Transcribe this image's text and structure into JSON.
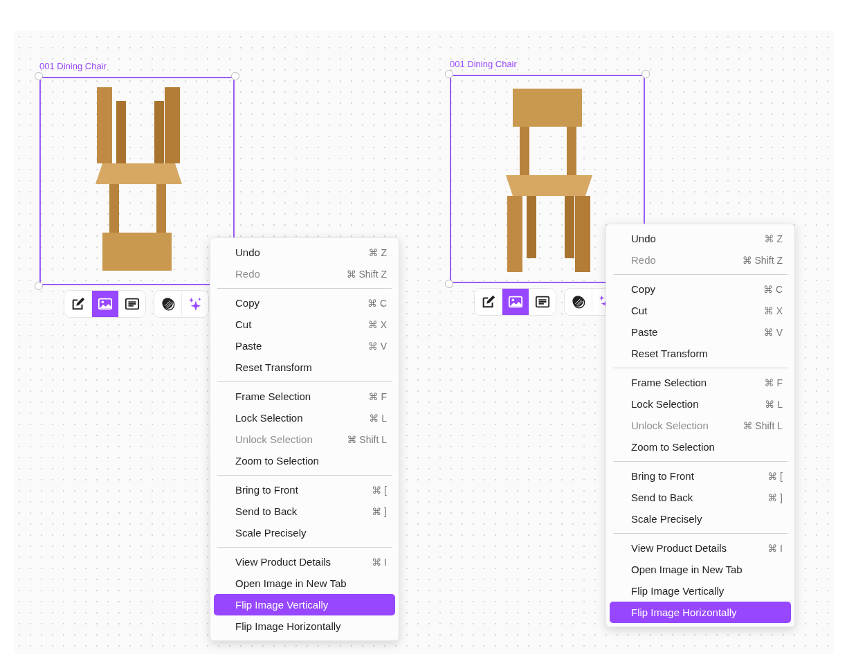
{
  "canvas": {
    "frames": [
      {
        "label": "001 Dining Chair",
        "image_flipped_vertically": true,
        "toolbar": [
          [
            {
              "kind": "edit",
              "selected": false
            },
            {
              "kind": "image",
              "selected": true
            },
            {
              "kind": "text",
              "selected": false
            }
          ],
          [
            {
              "kind": "mask",
              "selected": false
            },
            {
              "kind": "sparkle",
              "selected": false
            }
          ]
        ],
        "context_menu": {
          "sections": [
            [
              {
                "label": "Undo",
                "shortcut": "⌘ Z",
                "disabled": false,
                "selected": false
              },
              {
                "label": "Redo",
                "shortcut": "⌘ Shift Z",
                "disabled": true,
                "selected": false
              }
            ],
            [
              {
                "label": "Copy",
                "shortcut": "⌘ C",
                "disabled": false,
                "selected": false
              },
              {
                "label": "Cut",
                "shortcut": "⌘ X",
                "disabled": false,
                "selected": false
              },
              {
                "label": "Paste",
                "shortcut": "⌘ V",
                "disabled": false,
                "selected": false
              },
              {
                "label": "Reset Transform",
                "disabled": false,
                "selected": false
              }
            ],
            [
              {
                "label": "Frame Selection",
                "shortcut": "⌘ F",
                "disabled": false,
                "selected": false
              },
              {
                "label": "Lock Selection",
                "shortcut": "⌘ L",
                "disabled": false,
                "selected": false
              },
              {
                "label": "Unlock Selection",
                "shortcut": "⌘ Shift L",
                "disabled": true,
                "selected": false
              },
              {
                "label": "Zoom to Selection",
                "disabled": false,
                "selected": false
              }
            ],
            [
              {
                "label": "Bring to Front",
                "shortcut": "⌘ [",
                "disabled": false,
                "selected": false
              },
              {
                "label": "Send to Back",
                "shortcut": "⌘ ]",
                "disabled": false,
                "selected": false
              },
              {
                "label": "Scale Precisely",
                "disabled": false,
                "selected": false
              }
            ],
            [
              {
                "label": "View Product Details",
                "shortcut": "⌘ I",
                "disabled": false,
                "selected": false
              },
              {
                "label": "Open Image in New Tab",
                "disabled": false,
                "selected": false
              },
              {
                "label": "Flip Image Vertically",
                "disabled": false,
                "selected": true
              },
              {
                "label": "Flip Image Horizontally",
                "disabled": false,
                "selected": false
              }
            ]
          ]
        }
      },
      {
        "label": "001 Dining Chair",
        "image_flipped_vertically": false,
        "toolbar": [
          [
            {
              "kind": "edit",
              "selected": false
            },
            {
              "kind": "image",
              "selected": true
            },
            {
              "kind": "text",
              "selected": false
            }
          ],
          [
            {
              "kind": "mask",
              "selected": false
            },
            {
              "kind": "sparkle",
              "selected": false
            }
          ]
        ],
        "context_menu": {
          "sections": [
            [
              {
                "label": "Undo",
                "shortcut": "⌘ Z",
                "disabled": false,
                "selected": false
              },
              {
                "label": "Redo",
                "shortcut": "⌘ Shift Z",
                "disabled": true,
                "selected": false
              }
            ],
            [
              {
                "label": "Copy",
                "shortcut": "⌘ C",
                "disabled": false,
                "selected": false
              },
              {
                "label": "Cut",
                "shortcut": "⌘ X",
                "disabled": false,
                "selected": false
              },
              {
                "label": "Paste",
                "shortcut": "⌘ V",
                "disabled": false,
                "selected": false
              },
              {
                "label": "Reset Transform",
                "disabled": false,
                "selected": false
              }
            ],
            [
              {
                "label": "Frame Selection",
                "shortcut": "⌘ F",
                "disabled": false,
                "selected": false
              },
              {
                "label": "Lock Selection",
                "shortcut": "⌘ L",
                "disabled": false,
                "selected": false
              },
              {
                "label": "Unlock Selection",
                "shortcut": "⌘ Shift L",
                "disabled": true,
                "selected": false
              },
              {
                "label": "Zoom to Selection",
                "disabled": false,
                "selected": false
              }
            ],
            [
              {
                "label": "Bring to Front",
                "shortcut": "⌘ [",
                "disabled": false,
                "selected": false
              },
              {
                "label": "Send to Back",
                "shortcut": "⌘ ]",
                "disabled": false,
                "selected": false
              },
              {
                "label": "Scale Precisely",
                "disabled": false,
                "selected": false
              }
            ],
            [
              {
                "label": "View Product Details",
                "shortcut": "⌘ I",
                "disabled": false,
                "selected": false
              },
              {
                "label": "Open Image in New Tab",
                "disabled": false,
                "selected": false
              },
              {
                "label": "Flip Image Vertically",
                "disabled": false,
                "selected": false
              },
              {
                "label": "Flip Image Horizontally",
                "disabled": false,
                "selected": true
              }
            ]
          ]
        }
      }
    ]
  }
}
